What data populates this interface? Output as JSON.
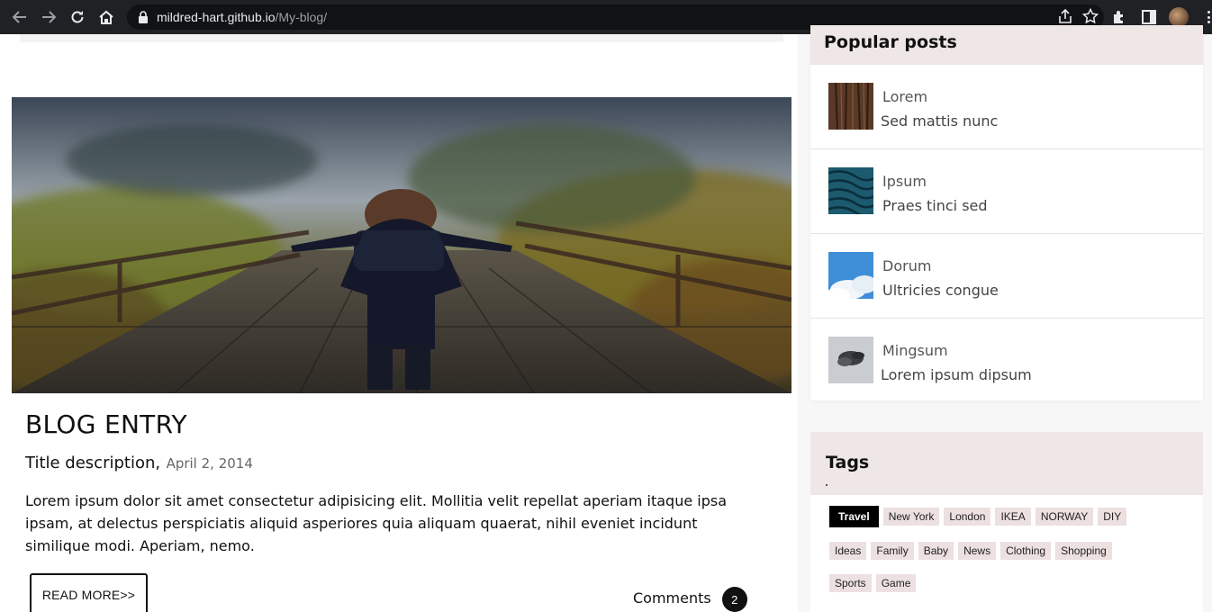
{
  "browser": {
    "url_host": "mildred-hart.github.io",
    "url_path": "/My-blog/"
  },
  "post": {
    "title": "BLOG ENTRY",
    "description": "Title description,",
    "date": "April 2, 2014",
    "excerpt": "Lorem ipsum dolor sit amet consectetur adipisicing elit. Mollitia velit repellat aperiam itaque ipsa ipsam, at delectus perspiciatis aliquid asperiores quia aliquam quaerat, nihil eveniet incidunt similique modi. Aperiam, nemo.",
    "read_more": "READ MORE>>",
    "comments_label": "Comments",
    "comments_count": "2"
  },
  "sidebar": {
    "popular_title": "Popular posts",
    "popular": [
      {
        "title": "Lorem",
        "subtitle": "Sed mattis nunc",
        "thumb": "wood-texture"
      },
      {
        "title": "Ipsum",
        "subtitle": "Praes tinci sed",
        "thumb": "blue-waves"
      },
      {
        "title": "Dorum",
        "subtitle": "Ultricies congue",
        "thumb": "sky-clouds"
      },
      {
        "title": "Mingsum",
        "subtitle": "Lorem ipsum dipsum",
        "thumb": "grey-cloud"
      }
    ],
    "tags_title": "Tags",
    "tags_row1": [
      "Travel",
      "New York",
      "London",
      "IKEA",
      "NORWAY",
      "DIY"
    ],
    "tags_row2": [
      "Ideas",
      "Family",
      "Baby",
      "News",
      "Clothing",
      "Shopping"
    ],
    "tags_row3": [
      "Sports",
      "Game"
    ],
    "active_tag": "Travel"
  },
  "colors": {
    "chrome_bg": "#202124",
    "panel_head_bg": "#efe6e6",
    "tag_bg": "#ede0e0",
    "active_tag_bg": "#000000"
  }
}
